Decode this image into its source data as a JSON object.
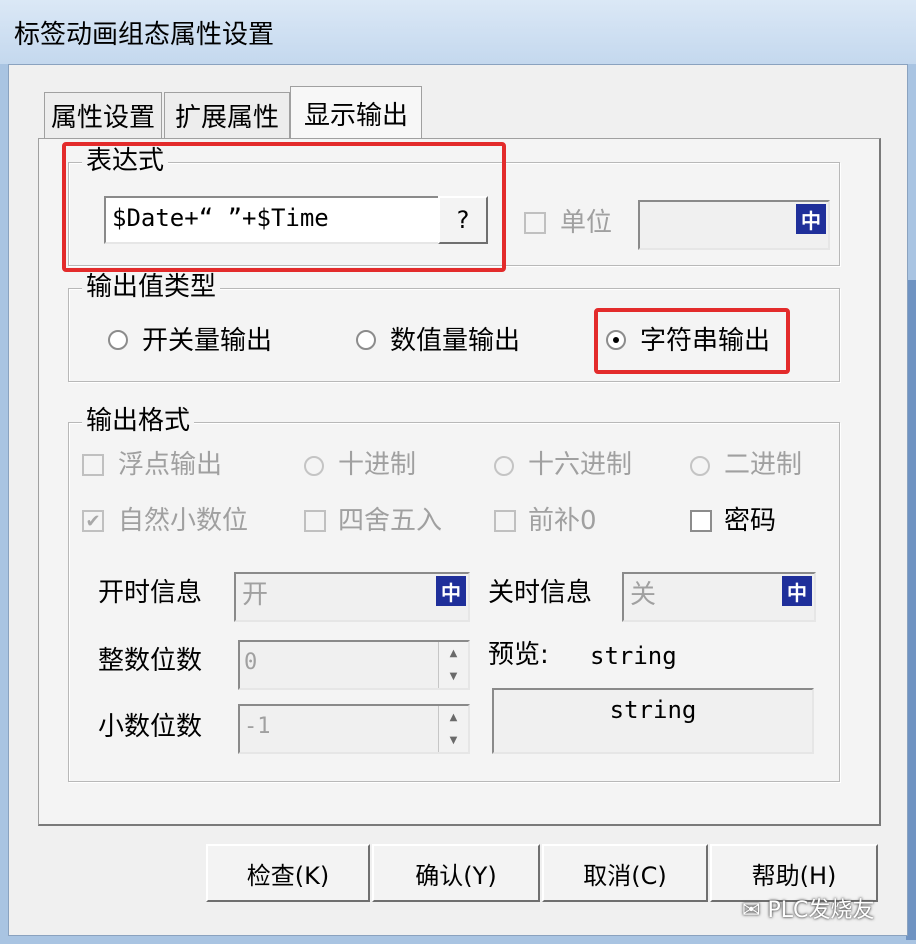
{
  "window": {
    "title": "标签动画组态属性设置"
  },
  "tabs": [
    {
      "label": "属性设置"
    },
    {
      "label": "扩展属性"
    },
    {
      "label": "显示输出"
    }
  ],
  "expression": {
    "legend": "表达式",
    "value": "$Date+“ ”+$Time",
    "button_label": "?",
    "unit_label": "单位",
    "unit_value": "",
    "zh_icon": "中"
  },
  "output_type": {
    "legend": "输出值类型",
    "options": [
      {
        "label": "开关量输出",
        "selected": false
      },
      {
        "label": "数值量输出",
        "selected": false
      },
      {
        "label": "字符串输出",
        "selected": true
      }
    ]
  },
  "output_format": {
    "legend": "输出格式",
    "row1": [
      {
        "label": "浮点输出",
        "kind": "checkbox",
        "checked": false,
        "enabled": false
      },
      {
        "label": "十进制",
        "kind": "radio",
        "checked": false,
        "enabled": false
      },
      {
        "label": "十六进制",
        "kind": "radio",
        "checked": false,
        "enabled": false
      },
      {
        "label": "二进制",
        "kind": "radio",
        "checked": false,
        "enabled": false
      }
    ],
    "row2": [
      {
        "label": "自然小数位",
        "kind": "checkbox",
        "checked": true,
        "enabled": false
      },
      {
        "label": "四舍五入",
        "kind": "checkbox",
        "checked": false,
        "enabled": false
      },
      {
        "label": "前补0",
        "kind": "checkbox",
        "checked": false,
        "enabled": false
      },
      {
        "label": "密码",
        "kind": "checkbox",
        "checked": false,
        "enabled": true
      }
    ],
    "on_info_label": "开时信息",
    "on_info_value": "开",
    "off_info_label": "关时信息",
    "off_info_value": "关",
    "int_digits_label": "整数位数",
    "int_digits_value": "0",
    "dec_digits_label": "小数位数",
    "dec_digits_value": "-1",
    "preview_label": "预览:",
    "preview_value": "string",
    "preview_box_value": "string"
  },
  "buttons": {
    "check": "检查(K)",
    "confirm": "确认(Y)",
    "cancel": "取消(C)",
    "help": "帮助(H)"
  },
  "watermark": "PLC发烧友",
  "colors": {
    "highlight": "#e32b2b",
    "zh_icon_bg": "#1f2f9a"
  }
}
